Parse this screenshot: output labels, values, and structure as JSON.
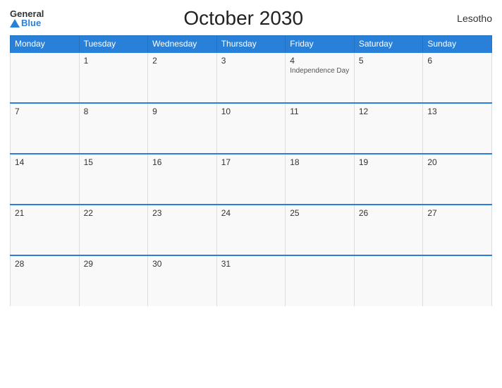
{
  "header": {
    "logo_general": "General",
    "logo_blue": "Blue",
    "title": "October 2030",
    "country": "Lesotho"
  },
  "days_of_week": [
    "Monday",
    "Tuesday",
    "Wednesday",
    "Thursday",
    "Friday",
    "Saturday",
    "Sunday"
  ],
  "weeks": [
    [
      {
        "day": "",
        "event": ""
      },
      {
        "day": "1",
        "event": ""
      },
      {
        "day": "2",
        "event": ""
      },
      {
        "day": "3",
        "event": ""
      },
      {
        "day": "4",
        "event": "Independence Day"
      },
      {
        "day": "5",
        "event": ""
      },
      {
        "day": "6",
        "event": ""
      }
    ],
    [
      {
        "day": "7",
        "event": ""
      },
      {
        "day": "8",
        "event": ""
      },
      {
        "day": "9",
        "event": ""
      },
      {
        "day": "10",
        "event": ""
      },
      {
        "day": "11",
        "event": ""
      },
      {
        "day": "12",
        "event": ""
      },
      {
        "day": "13",
        "event": ""
      }
    ],
    [
      {
        "day": "14",
        "event": ""
      },
      {
        "day": "15",
        "event": ""
      },
      {
        "day": "16",
        "event": ""
      },
      {
        "day": "17",
        "event": ""
      },
      {
        "day": "18",
        "event": ""
      },
      {
        "day": "19",
        "event": ""
      },
      {
        "day": "20",
        "event": ""
      }
    ],
    [
      {
        "day": "21",
        "event": ""
      },
      {
        "day": "22",
        "event": ""
      },
      {
        "day": "23",
        "event": ""
      },
      {
        "day": "24",
        "event": ""
      },
      {
        "day": "25",
        "event": ""
      },
      {
        "day": "26",
        "event": ""
      },
      {
        "day": "27",
        "event": ""
      }
    ],
    [
      {
        "day": "28",
        "event": ""
      },
      {
        "day": "29",
        "event": ""
      },
      {
        "day": "30",
        "event": ""
      },
      {
        "day": "31",
        "event": ""
      },
      {
        "day": "",
        "event": ""
      },
      {
        "day": "",
        "event": ""
      },
      {
        "day": "",
        "event": ""
      }
    ]
  ]
}
